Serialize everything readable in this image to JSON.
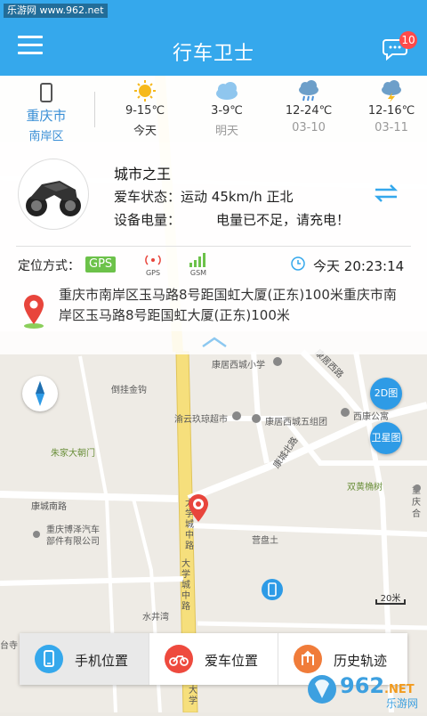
{
  "watermark": "乐游网 www.962.net",
  "header": {
    "title": "行车卫士",
    "badge": "10",
    "menu_icon": "menu-icon",
    "message_icon": "message-icon"
  },
  "weather": {
    "city": "重庆市",
    "district": "南岸区",
    "days": [
      {
        "temp": "9-15℃",
        "label": "今天",
        "icon": "sun-icon"
      },
      {
        "temp": "3-9℃",
        "label": "明天",
        "icon": "cloud-icon"
      },
      {
        "temp": "12-24℃",
        "label": "03-10",
        "icon": "rain-icon"
      },
      {
        "temp": "12-16℃",
        "label": "03-11",
        "icon": "thunder-rain-icon"
      }
    ]
  },
  "card": {
    "name": "城市之王",
    "status_label": "爱车状态：",
    "status_value": "运动  45km/h  正北",
    "battery_label": "设备电量：",
    "battery_value": "电量已不足，请充电！",
    "location_label": "定位方式：",
    "gps": "GPS",
    "signal_gps": "GPS",
    "signal_gsm": "GSM",
    "time_day": "今天",
    "time": "20:23:14",
    "address": "重庆市南岸区玉马路8号距国虹大厦(正东)100米重庆市南岸区玉马路8号距国虹大厦(正东)100米"
  },
  "map": {
    "labels": {
      "a": "康居西城小学",
      "b": "倒挂金钩",
      "c": "渝云玖琼超市",
      "d": "康居西城五组团",
      "e": "西康公寓",
      "f": "朱家大朝门",
      "g": "双黄桷树",
      "h": "康城南路",
      "i": "重庆博泽汽车部件有限公司",
      "j": "营盘土",
      "k": "水井湾",
      "l": "大学城中路",
      "m": "康居西路",
      "n": "康城北路",
      "o": "重庆合",
      "p": "大学城中路",
      "q": "台寺",
      "r": "大学"
    },
    "btn_2d": "2D图",
    "btn_satellite": "卫星图",
    "scale": "20米"
  },
  "tabs": [
    {
      "label": "手机位置",
      "icon": "phone-icon",
      "color": "#35a8ec"
    },
    {
      "label": "爱车位置",
      "icon": "motorbike-icon",
      "color": "#ee4a3e"
    },
    {
      "label": "历史轨迹",
      "icon": "history-track-icon",
      "color": "#f07c3a"
    }
  ],
  "brand": {
    "top": "962",
    "suffix": ".NET",
    "sub": "乐游网"
  }
}
